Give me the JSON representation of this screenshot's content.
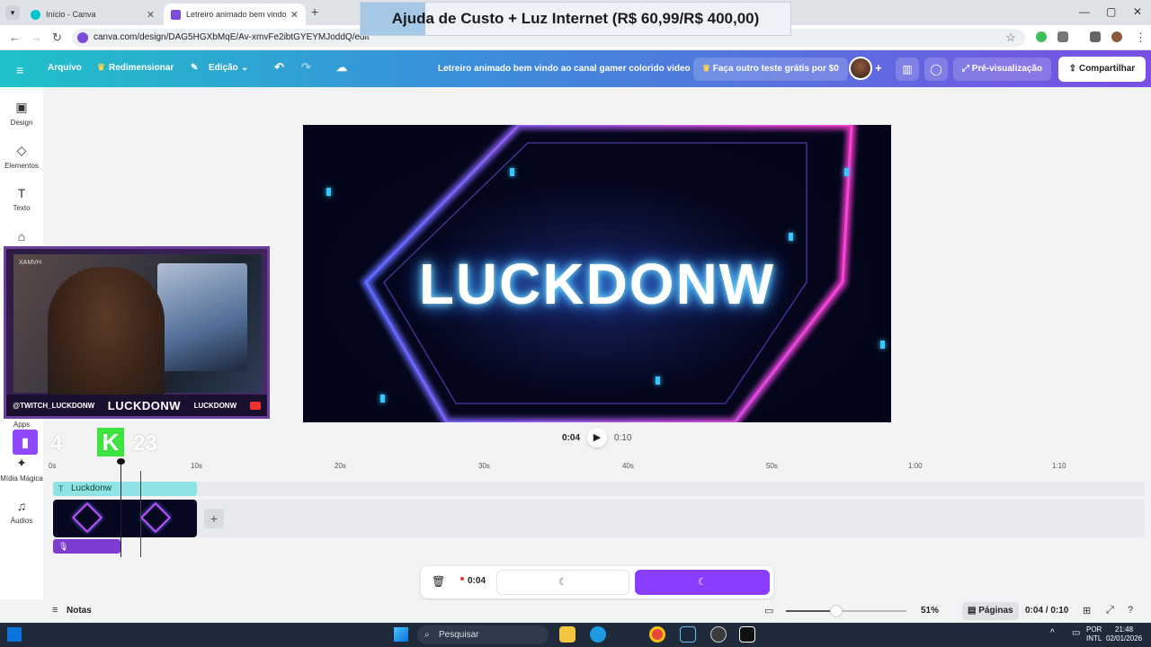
{
  "browser": {
    "tabs": [
      {
        "label": "Início - Canva",
        "active": false
      },
      {
        "label": "Letreiro animado bem vindo",
        "active": true
      }
    ],
    "new_tab": "+",
    "url": "canva.com/design/DAG5HGXbMqE/Av-xmvFe2ibtGYEYMJoddQ/edit"
  },
  "overlay_banner": "Ajuda de Custo + Luz Internet (R$ 60,99/R$ 400,00)",
  "header": {
    "menu_icon": "hamburger-icon",
    "file": "Arquivo",
    "resize": "Redimensionar",
    "edit": "Edição",
    "title": "Letreiro animado bem vindo ao canal gamer colorido video",
    "trial": "Faça outro teste grátis por $0",
    "preview": "Pré-visualização",
    "share": "Compartilhar"
  },
  "sidebar": {
    "items": [
      {
        "label": "Design",
        "icon": "layout-icon"
      },
      {
        "label": "Elementos",
        "icon": "shapes-icon"
      },
      {
        "label": "Texto",
        "icon": "text-icon"
      },
      {
        "label": "Apps",
        "icon": "apps-icon"
      },
      {
        "label": "Mídia Mágica",
        "icon": "magic-media-icon"
      },
      {
        "label": "Áudios",
        "icon": "music-icon"
      }
    ]
  },
  "webcam": {
    "handle": "@TWITCH_LUCKDONW",
    "name": "LUCKDONW",
    "name_small": "LUCKDONW",
    "badge": "XAMVH",
    "counter_left": "4",
    "counter_right": "23",
    "counter_letter": "K"
  },
  "canvas": {
    "headline": "LUCKDONW"
  },
  "playback": {
    "current": "0:04",
    "total": "0:10"
  },
  "timeline": {
    "ticks": [
      "0s",
      "10s",
      "20s",
      "30s",
      "40s",
      "50s",
      "1:00",
      "1:10"
    ],
    "text_track_label": "Luckdonw",
    "add_label": "+"
  },
  "actions": {
    "time": "0:04",
    "button1": "☾",
    "button2": "☾"
  },
  "footer": {
    "notes": "Notas",
    "zoom": "51%",
    "zoom_level": 0.51,
    "pages": "Páginas",
    "time": "0:04 / 0:10"
  },
  "taskbar": {
    "search": "Pesquisar",
    "lang_top": "POR",
    "lang_bottom": "INTL",
    "clock_time": "21:48",
    "clock_date": "02/01/2026"
  },
  "colors": {
    "canva_purple": "#8b3dff",
    "header_gradient_start": "#1fc1c9",
    "header_gradient_end": "#7a4fe3",
    "text_track": "#8ee4e4",
    "audio_track": "#7e3bd0"
  }
}
